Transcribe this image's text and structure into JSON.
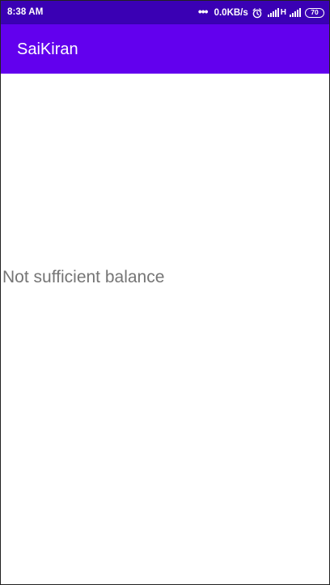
{
  "status_bar": {
    "time": "8:38 AM",
    "overflow_dots": "•••",
    "network_speed": "0.0KB/s",
    "network_type": "H",
    "battery_level": "70",
    "icons": [
      "alarm-icon",
      "signal-icon",
      "signal-icon",
      "battery-icon"
    ]
  },
  "app_bar": {
    "title": "SaiKiran"
  },
  "content": {
    "message": "Not sufficient balance"
  },
  "colors": {
    "status_bar_bg": "#3a00b4",
    "app_bar_bg": "#6200ee",
    "message_text": "#757575"
  }
}
